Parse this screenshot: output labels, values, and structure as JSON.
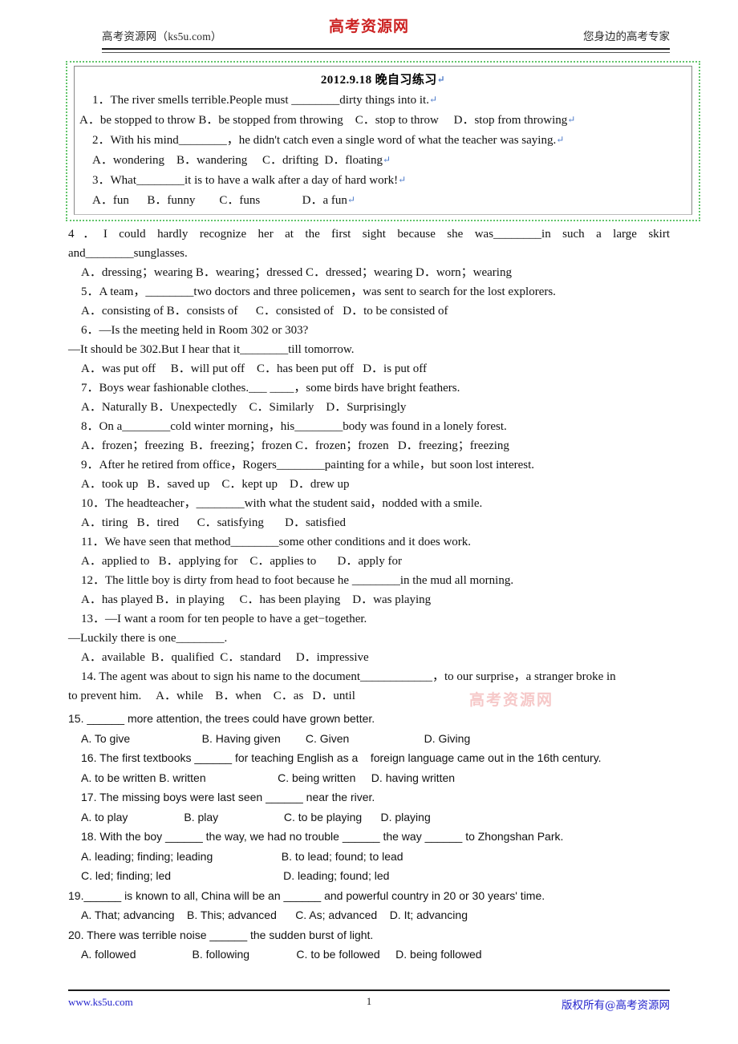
{
  "header": {
    "left_text": "高考资源网（ks5u.com）",
    "logo_text": "高考资源网",
    "right_text": "您身边的高考专家"
  },
  "boxed_block": {
    "title": "2012.9.18 晚自习练习",
    "paragraph_mark": "↵",
    "lines": [
      "1．The river smells terrible.People must ________dirty things into it.",
      "A．be stopped to throw B．be stopped from throwing    C．stop to throw     D．stop from throwing",
      "2．With his mind________，he didn't catch even a single word of what the teacher was saying.",
      "A．wondering    B．wandering     C．drifting  D．floating",
      "3．What________it is to have a walk after a day of hard work!",
      "A．fun      B．funny        C．funs              D．a fun"
    ]
  },
  "questions_serif": [
    "4．I could hardly recognize her at the first sight because she was________in such a large skirt",
    "and________sunglasses.",
    "A．dressing；wearing B．wearing；dressed C．dressed；wearing D．worn；wearing",
    "5．A team，________two doctors and three policemen，was sent to search for the lost explorers.",
    "A．consisting of B．consists of      C．consisted of   D．to be consisted of",
    "6．—Is the meeting held in Room 302 or 303?",
    "—It should be 302.But I hear that it________till tomorrow.",
    "A．was put off     B．will put off    C．has been put off   D．is put off",
    "7．Boys wear fashionable clothes.___ ____，some birds have bright feathers.",
    "A．Naturally B．Unexpectedly    C．Similarly    D．Surprisingly",
    "8．On a________cold winter morning，his________body was found in a lonely forest.",
    "A．frozen；freezing  B．freezing；frozen C．frozen；frozen   D．freezing；freezing",
    "9．After he retired from office，Rogers________painting for a while，but soon lost interest.",
    "A．took up   B．saved up    C．kept up    D．drew up",
    "10．The headteacher，________with what the student said，nodded with a smile.",
    "A．tiring   B．tired      C．satisfying       D．satisfied",
    "11．We have seen that method________some other conditions and it does work.",
    "A．applied to   B．applying for    C．applies to       D．apply for",
    "12．The little boy is dirty from head to foot because he ________in the mud all morning.",
    "A．has played B．in playing     C．has been playing    D．was playing",
    "13．—I want a room for ten people to have a get−together.",
    "—Luckily there is one________.",
    "A．available  B．qualified  C．standard     D．impressive",
    "14. The agent was about to sign his name to the document____________，to our surprise，a stranger broke in",
    "to prevent him.     A．while    B．when    C．as   D．until"
  ],
  "questions_sans": [
    "15. ______ more attention, the trees could have grown better.",
    "A. To give                       B. Having given        C. Given                        D. Giving",
    "16. The first textbooks ______ for teaching English as a    foreign language came out in the 16th century.",
    "A. to be written B. written                       C. being written     D. having written",
    "17. The missing boys were last seen ______ near the river.",
    "A. to play                  B. play                     C. to be playing      D. playing",
    "18. With the boy ______ the way, we had no trouble ______ the way ______ to Zhongshan Park.",
    "A. leading; finding; leading                      B. to lead; found; to lead",
    "C. led; finding; led                                    D. leading; found; led",
    "19.______ is known to all, China will be an ______ and powerful country in 20 or 30 years' time.",
    "A. That; advancing    B. This; advanced      C. As; advanced    D. It; advancing",
    "20. There was terrible noise ______ the sudden burst of light.",
    "A. followed                  B. following               C. to be followed     D. being followed"
  ],
  "watermark": {
    "text": "高考资源网"
  },
  "footer": {
    "left_url": "www.ks5u.com",
    "page_number": "1",
    "right_text": "版权所有@高考资源网"
  },
  "colors": {
    "logo_red": "#cc2222",
    "box_green": "#62c46a",
    "footer_blue": "#2222cc",
    "watermark_pink": "#f6c9c9"
  }
}
